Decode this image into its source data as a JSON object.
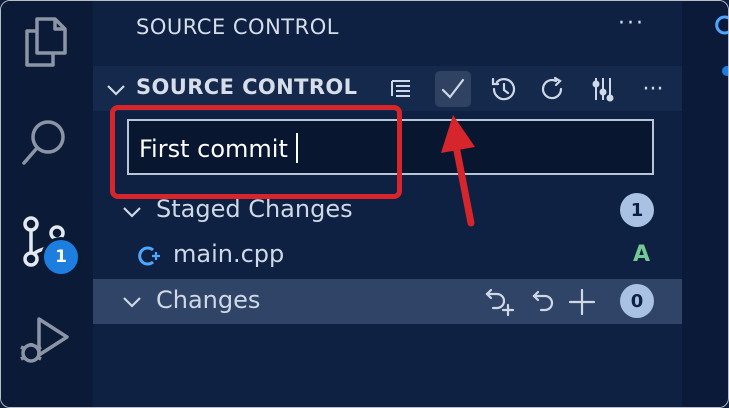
{
  "activity_bar": {
    "items": [
      {
        "name": "explorer",
        "icon": "files-icon"
      },
      {
        "name": "search",
        "icon": "search-icon"
      },
      {
        "name": "source-control",
        "icon": "source-control-icon",
        "badge": "1"
      },
      {
        "name": "run-debug",
        "icon": "run-debug-icon"
      }
    ]
  },
  "sidebar": {
    "title": "SOURCE CONTROL",
    "more": "···",
    "section": {
      "title": "SOURCE CONTROL",
      "toolbar": [
        "view-as-tree-icon",
        "commit-check-icon",
        "history-icon",
        "refresh-icon",
        "branch-graph-icon",
        "more-actions-icon"
      ],
      "more": "···"
    },
    "commit_message": "First commit",
    "staged": {
      "label": "Staged Changes",
      "count": "1",
      "files": [
        {
          "name": "main.cpp",
          "status": "A",
          "icon": "cpp-file-icon"
        }
      ]
    },
    "changes": {
      "label": "Changes",
      "count": "0",
      "actions": [
        "open-changes-icon",
        "discard-icon",
        "stage-all-icon"
      ]
    }
  },
  "colors": {
    "accent": "#1d7ee0",
    "annotation": "#d6262b",
    "added": "#73c991",
    "cpp_icon": "#4ea7ff"
  }
}
